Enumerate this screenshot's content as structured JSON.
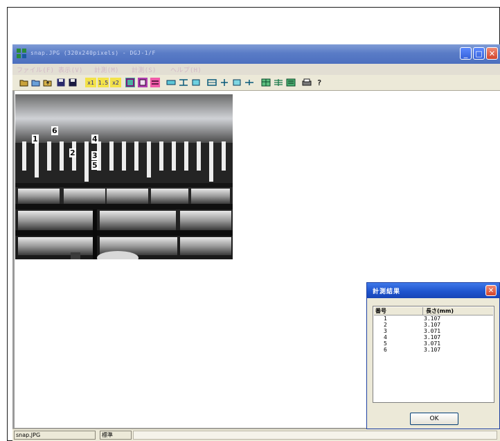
{
  "window": {
    "title": "snap.JPG (320x240pixels) - DGJ-1/F",
    "icon": "app-grid-icon",
    "controls": {
      "minimize": "_",
      "maximize": "□",
      "close": "✕"
    }
  },
  "menu": {
    "items": [
      "ファイル(F)",
      "表示(V)",
      "計測(M)",
      "計測(S)",
      "ヘルプ(H)"
    ]
  },
  "toolbar": {
    "buttons": [
      {
        "icon": "open-folder-icon",
        "label": ""
      },
      {
        "icon": "open-image-icon",
        "label": ""
      },
      {
        "icon": "folder-up-icon",
        "label": ""
      },
      {
        "icon": "save-icon",
        "label": ""
      },
      {
        "icon": "save-as-icon",
        "label": ""
      },
      {
        "icon": "zoom-half-icon",
        "label": "x1"
      },
      {
        "icon": "zoom-1-5-icon",
        "label": "1.5"
      },
      {
        "icon": "zoom-double-icon",
        "label": "x2"
      },
      {
        "icon": "image-fit-icon",
        "label": ""
      },
      {
        "icon": "image-frame-icon",
        "label": ""
      },
      {
        "icon": "pink-tool-icon",
        "label": ""
      },
      {
        "icon": "measure-length-icon",
        "label": ""
      },
      {
        "icon": "measure-width-icon",
        "label": ""
      },
      {
        "icon": "measure-box-icon",
        "label": ""
      },
      {
        "icon": "measure-angle-icon",
        "label": ""
      },
      {
        "icon": "measure-radius-icon",
        "label": ""
      },
      {
        "icon": "measure-circle-icon",
        "label": ""
      },
      {
        "icon": "measure-distance-icon",
        "label": ""
      },
      {
        "icon": "table-icon",
        "label": ""
      },
      {
        "icon": "grid-icon",
        "label": ""
      },
      {
        "icon": "list-icon",
        "label": ""
      },
      {
        "icon": "print-icon",
        "label": ""
      },
      {
        "icon": "help-icon",
        "label": "?"
      }
    ]
  },
  "image": {
    "markers": [
      "1",
      "6",
      "4",
      "2",
      "3",
      "5"
    ]
  },
  "statusbar": {
    "file": "snap.JPG",
    "mode": "標準"
  },
  "dialog": {
    "title": "計測結果",
    "close": "✕",
    "columns": [
      "番号",
      "長さ(mm)"
    ],
    "rows": [
      {
        "no": "1",
        "len": "3.107"
      },
      {
        "no": "2",
        "len": "3.107"
      },
      {
        "no": "3",
        "len": "3.071"
      },
      {
        "no": "4",
        "len": "3.107"
      },
      {
        "no": "5",
        "len": "3.071"
      },
      {
        "no": "6",
        "len": "3.107"
      }
    ],
    "ok": "OK"
  },
  "colors": {
    "titlebar": "#5a7cc6",
    "dialog_titlebar": "#1f55cf",
    "close": "#d2452b",
    "chrome": "#ece9d8"
  }
}
